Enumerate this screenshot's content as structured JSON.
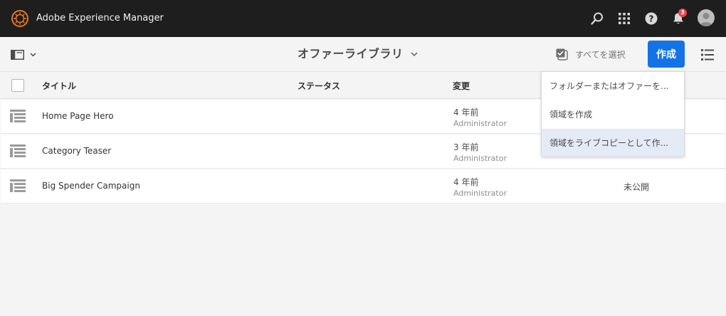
{
  "shell": {
    "app_title": "Adobe Experience Manager",
    "notification_count": "3",
    "icons": [
      "search-icon",
      "apps-grid-icon",
      "help-icon",
      "bell-icon",
      "avatar"
    ]
  },
  "actionbar": {
    "title": "オファーライブラリ",
    "select_all": "すべてを選択",
    "create": "作成"
  },
  "table": {
    "headers": {
      "title": "タイトル",
      "status": "ステータス",
      "modified": "変更"
    },
    "rows": [
      {
        "title": "Home Page Hero",
        "date": "4 年前",
        "user": "Administrator",
        "published": ""
      },
      {
        "title": "Category Teaser",
        "date": "3 年前",
        "user": "Administrator",
        "published": ""
      },
      {
        "title": "Big Spender Campaign",
        "date": "4 年前",
        "user": "Administrator",
        "published": "未公開"
      }
    ]
  },
  "create_menu": {
    "items": [
      {
        "label": "フォルダーまたはオファーを..."
      },
      {
        "label": "領域を作成"
      },
      {
        "label": "領域をライブコピーとして作..."
      }
    ],
    "active_index": 2
  },
  "colors": {
    "shell_bg": "#1e1e1e",
    "accent": "#1473e6",
    "badge": "#e34850",
    "logo": "#e87722"
  }
}
